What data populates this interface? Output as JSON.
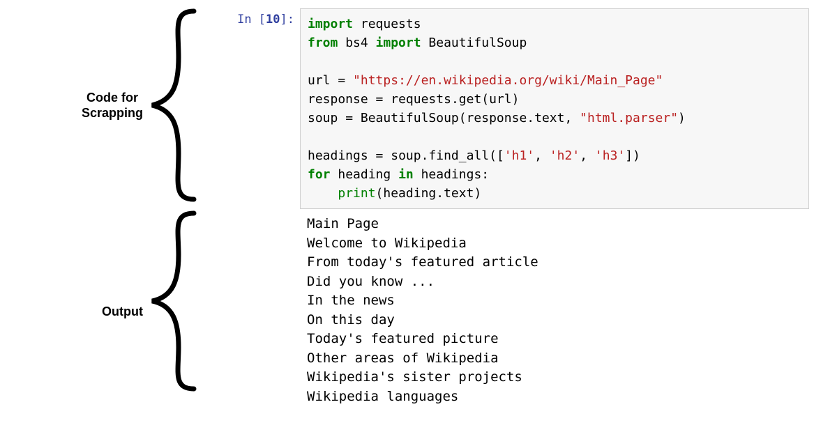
{
  "labels": {
    "code": "Code for\nScrapping",
    "output": "Output"
  },
  "prompt": {
    "in": "In [",
    "num": "10",
    "close": "]:"
  },
  "code": {
    "l1a": "import",
    "l1b": " requests",
    "l2a": "from",
    "l2b": " bs4 ",
    "l2c": "import",
    "l2d": " BeautifulSoup",
    "l4a": "url ",
    "l4b": "=",
    "l4c": " ",
    "l4d": "\"https://en.wikipedia.org/wiki/Main_Page\"",
    "l5a": "response ",
    "l5b": "=",
    "l5c": " requests",
    "l5d": ".",
    "l5e": "get(url)",
    "l6a": "soup ",
    "l6b": "=",
    "l6c": " BeautifulSoup(response",
    "l6d": ".",
    "l6e": "text, ",
    "l6f": "\"html.parser\"",
    "l6g": ")",
    "l8a": "headings ",
    "l8b": "=",
    "l8c": " soup",
    "l8d": ".",
    "l8e": "find_all([",
    "l8f": "'h1'",
    "l8g": ", ",
    "l8h": "'h2'",
    "l8i": ", ",
    "l8j": "'h3'",
    "l8k": "])",
    "l9a": "for",
    "l9b": " heading ",
    "l9c": "in",
    "l9d": " headings:",
    "l10a": "    ",
    "l10b": "print",
    "l10c": "(heading",
    "l10d": ".",
    "l10e": "text)"
  },
  "output_lines": [
    "Main Page",
    "Welcome to Wikipedia",
    "From today's featured article",
    "Did you know ...",
    "In the news",
    "On this day",
    "Today's featured picture",
    "Other areas of Wikipedia",
    "Wikipedia's sister projects",
    "Wikipedia languages"
  ]
}
